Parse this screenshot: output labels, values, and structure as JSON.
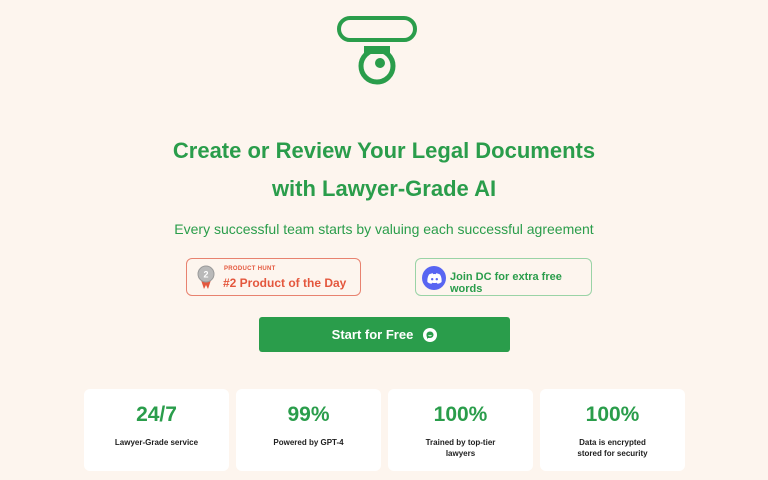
{
  "logo": {
    "name": "brand-logo"
  },
  "hero": {
    "title_line1": "Create or Review Your Legal Documents",
    "title_line2": "with Lawyer-Grade AI",
    "subtitle": "Every successful team starts by valuing each successful agreement"
  },
  "badges": {
    "producthunt": {
      "kicker": "PRODUCT HUNT",
      "title": "#2 Product of the Day",
      "icon": "medal-icon",
      "medal_number": "2"
    },
    "discord": {
      "label": "Join DC for extra free words",
      "icon": "discord-icon"
    }
  },
  "cta": {
    "label": "Start for Free",
    "icon": "chat-bubble-icon"
  },
  "stats": [
    {
      "value": "24/7",
      "label": "Lawyer-Grade service"
    },
    {
      "value": "99%",
      "label": "Powered by GPT-4"
    },
    {
      "value": "100%",
      "label": "Trained by top-tier lawyers"
    },
    {
      "value": "100%",
      "label": "Data is encrypted stored for security"
    }
  ],
  "colors": {
    "accent": "#2a9d4b",
    "background": "#fdf5ee",
    "producthunt": "#e4573d",
    "discord": "#5865f2"
  }
}
